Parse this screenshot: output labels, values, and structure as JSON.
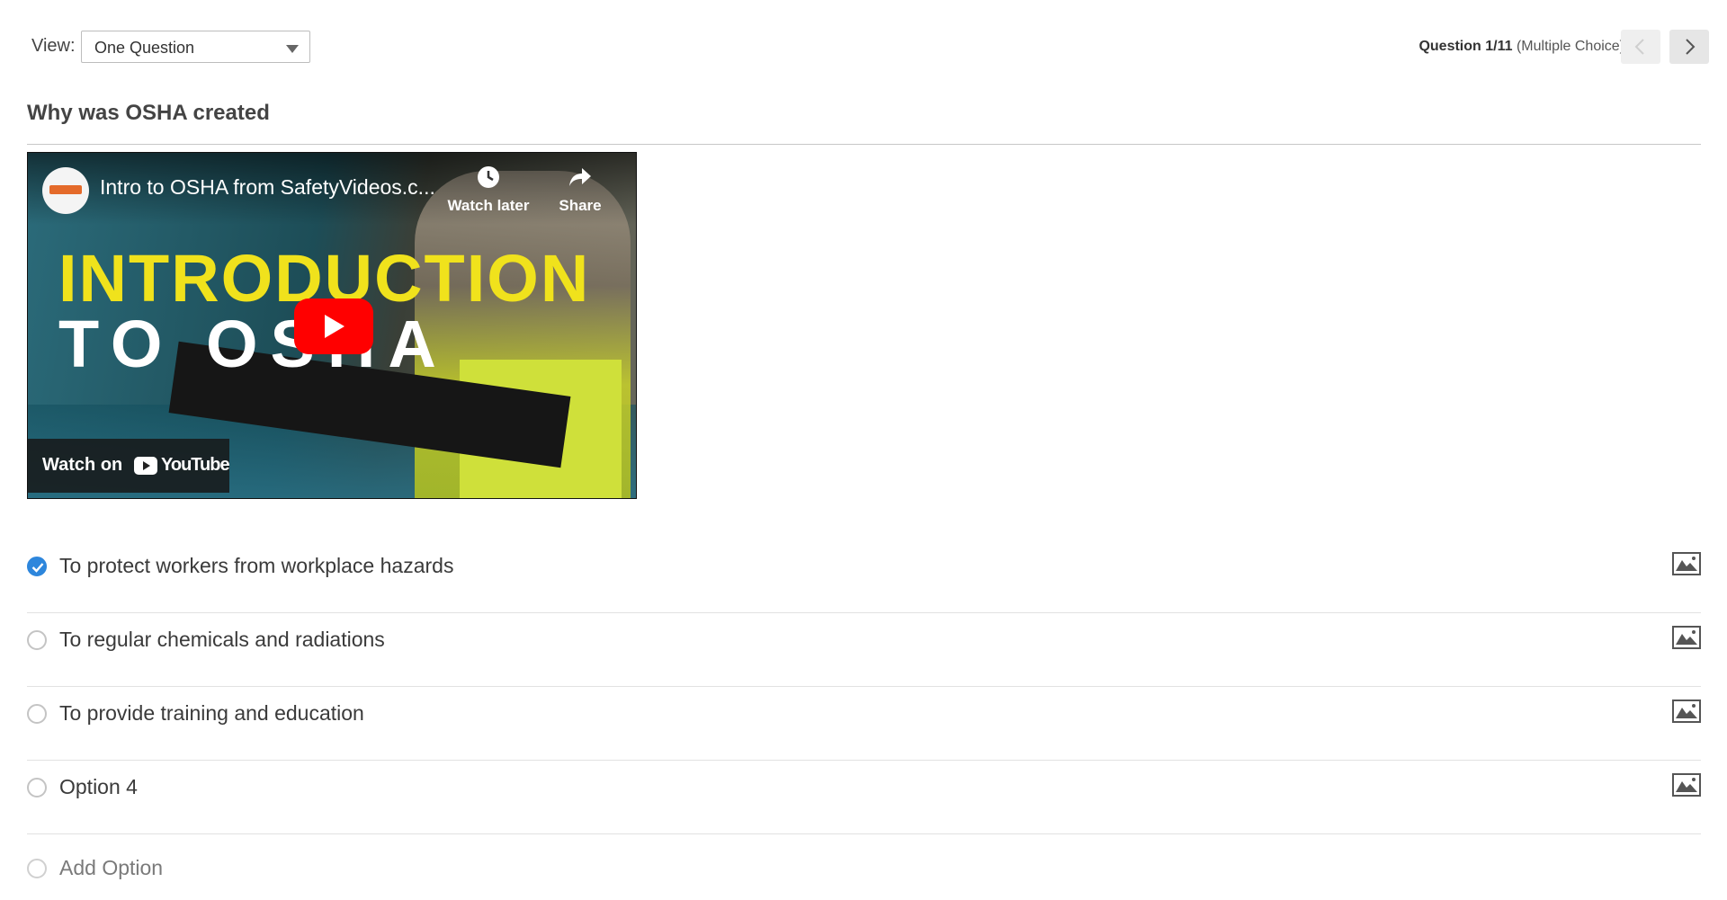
{
  "view": {
    "label": "View:",
    "selected": "One Question"
  },
  "question_info": {
    "counter": "Question 1/11",
    "type": "(Multiple Choice)"
  },
  "question": {
    "title": "Why was OSHA created"
  },
  "video": {
    "title": "Intro to OSHA from SafetyVideos.c...",
    "watch_later": "Watch later",
    "share": "Share",
    "thumb_line1": "INTRODUCTION",
    "thumb_line2": "TO OSHA",
    "watch_on": "Watch on",
    "platform": "YouTube"
  },
  "options": [
    {
      "label": "To protect workers from workplace hazards",
      "selected": true
    },
    {
      "label": "To regular chemicals and radiations",
      "selected": false
    },
    {
      "label": "To provide training and education",
      "selected": false
    },
    {
      "label": "Option 4",
      "selected": false
    }
  ],
  "add_option": {
    "label": "Add Option"
  },
  "colors": {
    "accent": "#2d86dc",
    "play": "#ff0000",
    "thumb_yellow": "#f0e21c"
  },
  "icons": {
    "prev": "chevron-left-icon",
    "next": "chevron-right-icon",
    "dropdown": "caret-down-icon",
    "option_image": "image-icon",
    "checked": "check-icon"
  }
}
